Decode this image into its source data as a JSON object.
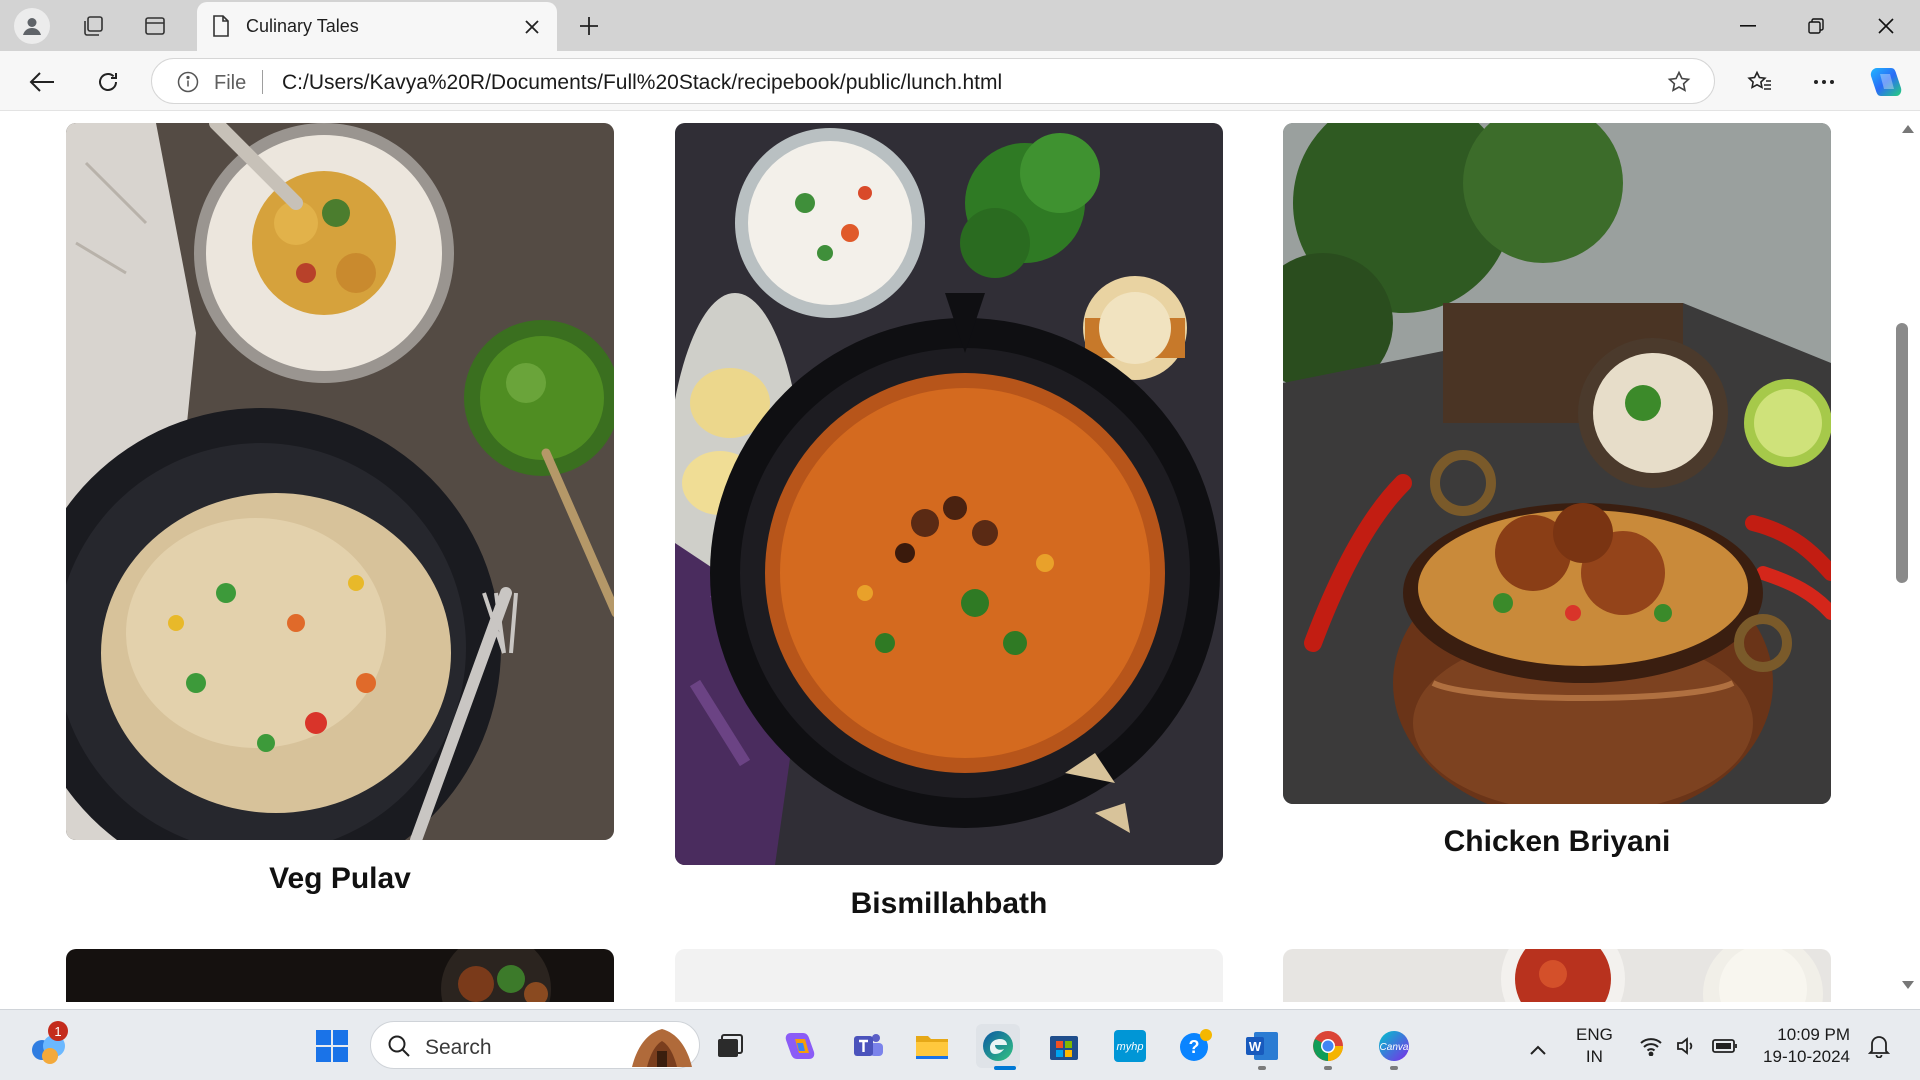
{
  "browser": {
    "tab": {
      "title": "Culinary Tales"
    },
    "address": {
      "scheme_label": "File",
      "url": "C:/Users/Kavya%20R/Documents/Full%20Stack/recipebook/public/lunch.html"
    }
  },
  "page": {
    "dishes": [
      {
        "name": "Veg Pulav"
      },
      {
        "name": "Bismillahbath"
      },
      {
        "name": "Chicken Briyani"
      }
    ]
  },
  "taskbar": {
    "search_label": "Search",
    "widgets_badge": "1",
    "language": {
      "line1": "ENG",
      "line2": "IN"
    },
    "clock": {
      "time": "10:09 PM",
      "date": "19-10-2024"
    }
  },
  "colors": {
    "accent": "#0078d4",
    "tab_bar": "#d3d3d3",
    "toolbar": "#f7f7f7",
    "title_text": "#111111"
  }
}
